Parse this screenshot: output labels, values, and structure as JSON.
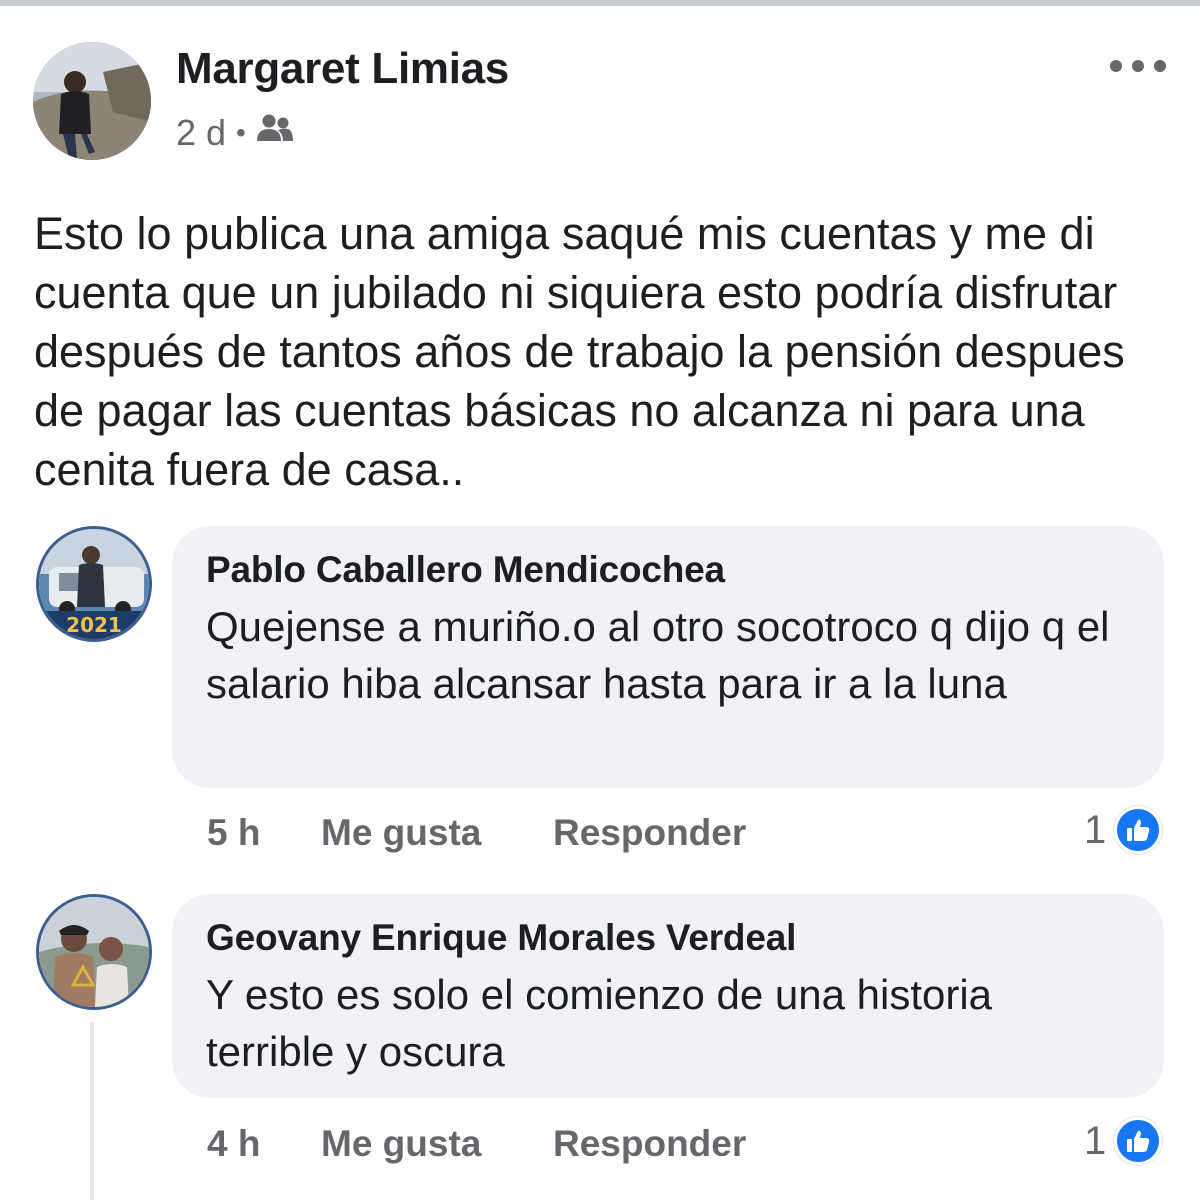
{
  "post": {
    "author": "Margaret Limias",
    "time": "2 d",
    "audience_icon": "friends-icon",
    "menu_icon": "more-horizontal-icon",
    "text": "Esto lo publica una amiga saqué mis cuentas y me di cuenta que un jubilado ni siquiera esto podría disfrutar después de tantos años de trabajo la pensión despues de pagar las cuentas básicas no alcanza ni para una cenita fuera de casa.."
  },
  "comments": [
    {
      "author": "Pablo Caballero Mendicochea",
      "text": "Quejense a muriño.o al otro socotroco q dijo q el salario hiba alcansar hasta para ir a la luna",
      "avatar_caption": "2021",
      "time": "5 h",
      "like_label": "Me gusta",
      "reply_label": "Responder",
      "reaction_count": "1",
      "reaction_icon": "thumbs-up-icon"
    },
    {
      "author": "Geovany Enrique Morales Verdeal",
      "text": "Y esto es solo el comienzo de una historia terrible y oscura",
      "time": "4 h",
      "like_label": "Me gusta",
      "reply_label": "Responder",
      "reaction_count": "1",
      "reaction_icon": "thumbs-up-icon"
    }
  ],
  "colors": {
    "accent": "#1877f2",
    "bubble": "#f0f2f5",
    "secondary_text": "#65676b"
  }
}
